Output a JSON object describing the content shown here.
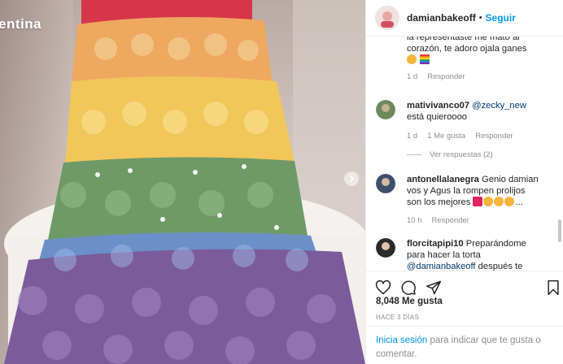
{
  "post": {
    "image_caption": "entina",
    "carousel_next": "chevron-right-icon"
  },
  "header": {
    "username": "damianbakeoff",
    "separator": "•",
    "follow_label": "Seguir"
  },
  "comments": [
    {
      "text": "la representaste me mato al corazón, te adoro ojala ganes",
      "emojis": [
        "heart-eyes-emoji",
        "rainbow-flag-emoji"
      ],
      "time": "1 d",
      "reply_label": "Responder"
    },
    {
      "username": "mativivanco07",
      "mention": "@zecky_new",
      "text": "está quieroooo",
      "time": "1 d",
      "likes": "1 Me gusta",
      "reply_label": "Responder",
      "view_replies": "Ver respuestas (2)"
    },
    {
      "username": "antonellalanegra",
      "text": "Genio damian vos y Agus la rompen prolijos son los mejores",
      "emojis": [
        "red-heart-emoji",
        "flexed-biceps-emoji",
        "clapping-hands-emoji",
        "clapping-hands-emoji"
      ],
      "trailing": "...",
      "time": "10 h",
      "reply_label": "Responder"
    },
    {
      "username": "florcitapipi10",
      "text": "Preparándome para hacer la torta",
      "mention": "@damianbakeoff",
      "text_after": "después te"
    }
  ],
  "actions": {
    "like": "heart-icon",
    "comment": "comment-bubble-icon",
    "share": "paper-plane-icon",
    "save": "bookmark-icon"
  },
  "likes_count": "8,048 Me gusta",
  "timestamp": "HACE 3 DÍAS",
  "login": {
    "link": "Inicia sesión",
    "text": "para indicar que te gusta o comentar."
  },
  "colors": {
    "link_blue": "#0095f6",
    "mention_blue": "#00376b",
    "muted_gray": "#8e8e8e",
    "border": "#efefef"
  }
}
